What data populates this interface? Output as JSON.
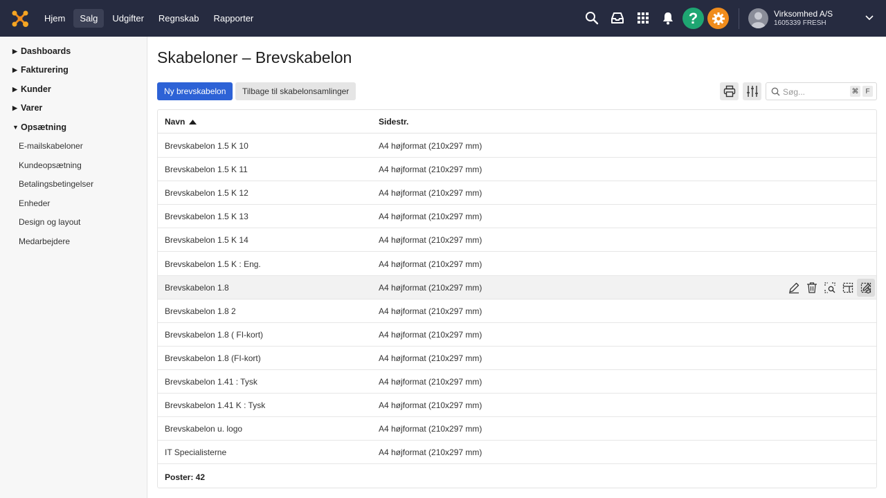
{
  "topnav": {
    "items": [
      {
        "label": "Hjem",
        "active": false
      },
      {
        "label": "Salg",
        "active": true
      },
      {
        "label": "Udgifter",
        "active": false
      },
      {
        "label": "Regnskab",
        "active": false
      },
      {
        "label": "Rapporter",
        "active": false
      }
    ],
    "icons": [
      "search-icon",
      "inbox-icon",
      "apps-grid-icon",
      "bell-icon",
      "help-icon",
      "gear-icon"
    ],
    "help_label": "?",
    "company_name": "Virksomhed A/S",
    "company_sub": "1605339 FRESH"
  },
  "sidebar": {
    "groups": [
      {
        "label": "Dashboards",
        "expanded": false
      },
      {
        "label": "Fakturering",
        "expanded": false
      },
      {
        "label": "Kunder",
        "expanded": false
      },
      {
        "label": "Varer",
        "expanded": false
      },
      {
        "label": "Opsætning",
        "expanded": true
      }
    ],
    "sub_items": [
      "E-mailskabeloner",
      "Kundeopsætning",
      "Betalingsbetingelser",
      "Enheder",
      "Design og layout",
      "Medarbejdere"
    ]
  },
  "main": {
    "title": "Skabeloner – Brevskabelon",
    "primary_button": "Ny brevskabelon",
    "secondary_button": "Tilbage til skabelonsamlinger",
    "search_placeholder": "Søg...",
    "shortcut_keys": [
      "⌘",
      "F"
    ]
  },
  "table": {
    "columns": [
      "Navn",
      "Sidestr."
    ],
    "sort_column": "Navn",
    "sort_direction": "ascending",
    "rows": [
      {
        "name": "Brevskabelon 1.5 K 10",
        "size": "A4 højformat (210x297 mm)"
      },
      {
        "name": "Brevskabelon 1.5 K 11",
        "size": "A4 højformat (210x297 mm)"
      },
      {
        "name": "Brevskabelon 1.5 K 12",
        "size": "A4 højformat (210x297 mm)"
      },
      {
        "name": "Brevskabelon 1.5 K 13",
        "size": "A4 højformat (210x297 mm)"
      },
      {
        "name": "Brevskabelon 1.5 K 14",
        "size": "A4 højformat (210x297 mm)"
      },
      {
        "name": "Brevskabelon 1.5 K : Eng.",
        "size": "A4 højformat (210x297 mm)"
      },
      {
        "name": "Brevskabelon 1.8",
        "size": "A4 højformat (210x297 mm)"
      },
      {
        "name": "Brevskabelon 1.8 2",
        "size": "A4 højformat (210x297 mm)"
      },
      {
        "name": "Brevskabelon 1.8 ( FI-kort)",
        "size": "A4 højformat (210x297 mm)"
      },
      {
        "name": "Brevskabelon 1.8 (FI-kort)",
        "size": "A4 højformat (210x297 mm)"
      },
      {
        "name": "Brevskabelon 1.41 : Tysk",
        "size": "A4 højformat (210x297 mm)"
      },
      {
        "name": "Brevskabelon 1.41 K : Tysk",
        "size": "A4 højformat (210x297 mm)"
      },
      {
        "name": "Brevskabelon u. logo",
        "size": "A4 højformat (210x297 mm)"
      },
      {
        "name": "IT Specialisterne",
        "size": "A4 højformat (210x297 mm)"
      }
    ],
    "hovered_row": 6,
    "row_actions": [
      "edit-icon",
      "delete-icon",
      "preview-icon",
      "layout-icon",
      "edit-design-icon"
    ],
    "footer": "Poster: 42"
  },
  "colors": {
    "topbar": "#262b40",
    "primary": "#2d62d6",
    "help": "#1ea672",
    "settings": "#f08c1c"
  }
}
